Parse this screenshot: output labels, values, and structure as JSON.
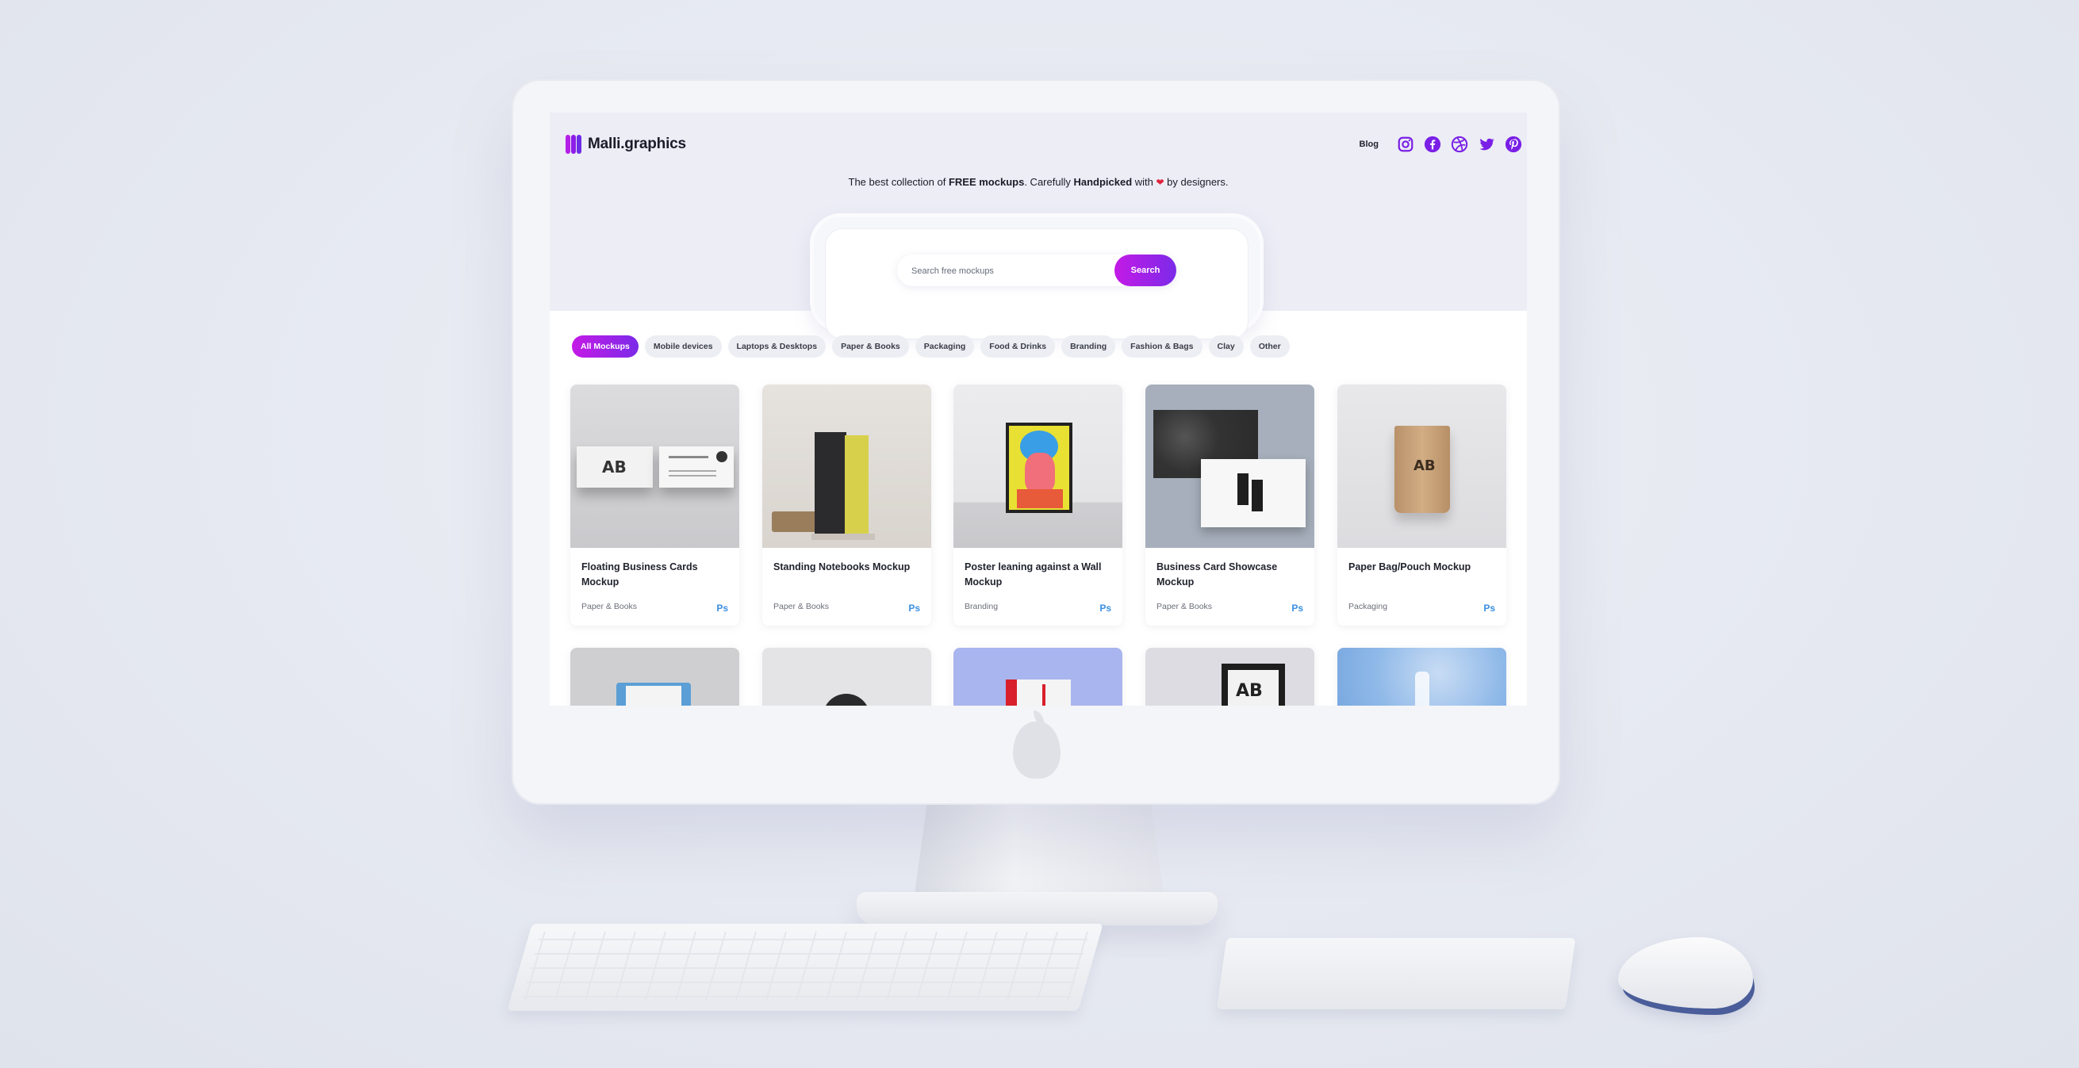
{
  "site": {
    "brand": "Malli.graphics",
    "blog": "Blog"
  },
  "social": [
    "instagram-icon",
    "facebook-icon",
    "dribbble-icon",
    "twitter-icon",
    "pinterest-icon"
  ],
  "hero": {
    "tag_part1": "The best collection of ",
    "tag_free": "FREE mockups",
    "tag_part2": ". Carefully ",
    "tag_handpicked": "Handpicked",
    "tag_part3": " with ",
    "tag_part4": " by designers."
  },
  "search": {
    "placeholder": "Search free mockups",
    "button": "Search"
  },
  "filters": [
    "All Mockups",
    "Mobile devices",
    "Laptops & Desktops",
    "Paper & Books",
    "Packaging",
    "Food & Drinks",
    "Branding",
    "Fashion & Bags",
    "Clay",
    "Other"
  ],
  "cards": [
    {
      "title": "Floating Business Cards Mockup",
      "category": "Paper & Books",
      "badge": "Ps"
    },
    {
      "title": "Standing Notebooks Mockup",
      "category": "Paper & Books",
      "badge": "Ps"
    },
    {
      "title": "Poster leaning against a Wall Mockup",
      "category": "Branding",
      "badge": "Ps"
    },
    {
      "title": "Business Card Showcase Mockup",
      "category": "Paper & Books",
      "badge": "Ps"
    },
    {
      "title": "Paper Bag/Pouch Mockup",
      "category": "Packaging",
      "badge": "Ps"
    }
  ],
  "colors": {
    "accent_start": "#c41ae6",
    "accent_end": "#7b2ae8",
    "ps_blue": "#3a8fe0",
    "heart": "#e0203a"
  }
}
